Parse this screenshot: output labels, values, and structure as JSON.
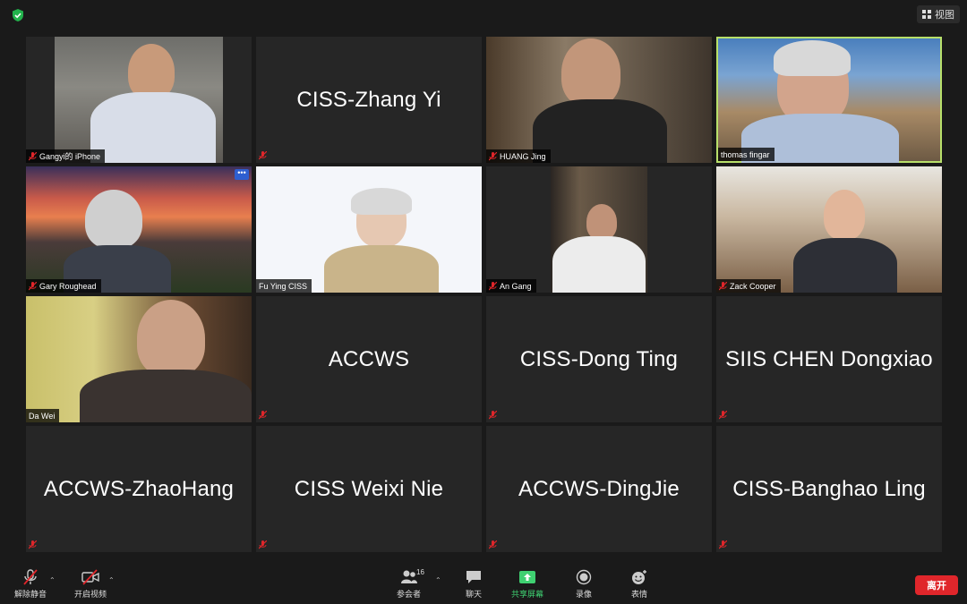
{
  "top": {
    "view_label": "视图"
  },
  "tiles": [
    {
      "name": "Gangyi的 iPhone",
      "type": "video"
    },
    {
      "name": "CISS-Zhang Yi",
      "type": "name"
    },
    {
      "name": "HUANG Jing",
      "type": "video"
    },
    {
      "name": "thomas fingar",
      "type": "video",
      "active": true
    },
    {
      "name": "Gary Roughead",
      "type": "video"
    },
    {
      "name": "Fu Ying CISS",
      "type": "video"
    },
    {
      "name": "An Gang",
      "type": "video"
    },
    {
      "name": "Zack Cooper",
      "type": "video"
    },
    {
      "name": "Da Wei",
      "type": "video"
    },
    {
      "name": "ACCWS",
      "type": "name"
    },
    {
      "name": "CISS-Dong Ting",
      "type": "name"
    },
    {
      "name": "SIIS CHEN Dongxiao",
      "type": "name"
    },
    {
      "name": "ACCWS-ZhaoHang",
      "type": "name"
    },
    {
      "name": "CISS Weixi Nie",
      "type": "name"
    },
    {
      "name": "ACCWS-DingJie",
      "type": "name"
    },
    {
      "name": "CISS-Banghao Ling",
      "type": "name"
    }
  ],
  "more_label": "•••",
  "toolbar": {
    "unmute": "解除静音",
    "start_video": "开启视频",
    "participants": "参会者",
    "participants_count": "16",
    "chat": "聊天",
    "share": "共享屏幕",
    "record": "录像",
    "reactions": "表情",
    "leave": "离开"
  },
  "colors": {
    "accent_green": "#3fd071",
    "active_border": "#b8e06a",
    "leave_red": "#e0262b",
    "muted_red": "#e0262b"
  }
}
